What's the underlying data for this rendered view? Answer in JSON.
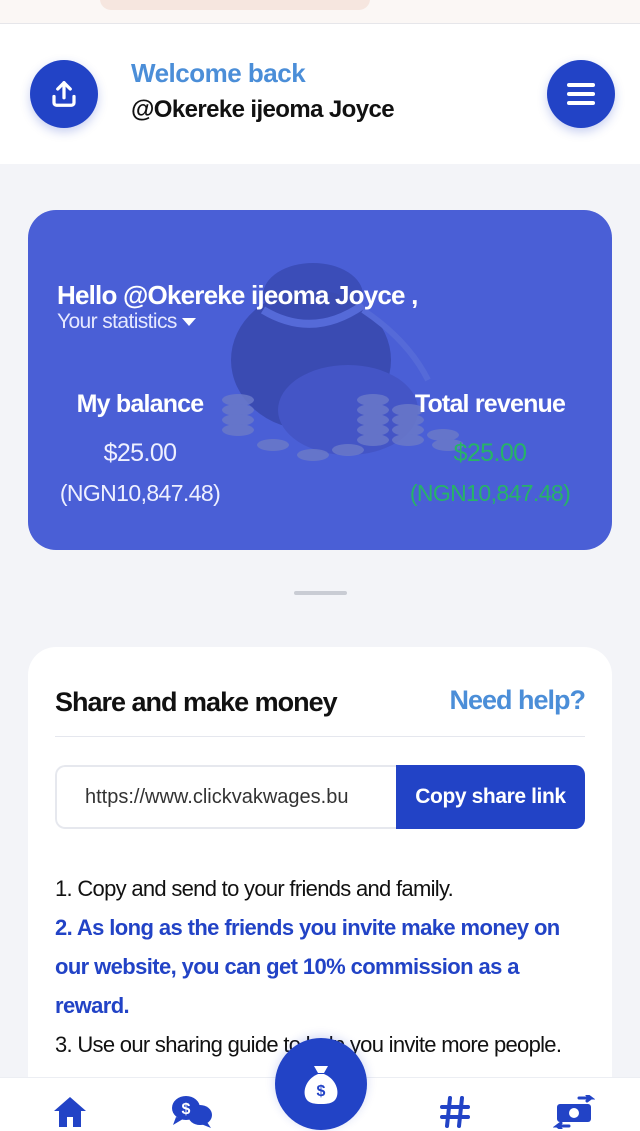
{
  "header": {
    "welcome": "Welcome back",
    "username": "@Okereke ijeoma Joyce"
  },
  "stats": {
    "greeting": "Hello @Okereke ijeoma Joyce ,",
    "subtitle": "Your statistics",
    "balance": {
      "label": "My balance",
      "usd": "$25.00",
      "ngn": "(NGN10,847.48)"
    },
    "revenue": {
      "label": "Total revenue",
      "usd": "$25.00",
      "ngn": "(NGN10,847.48)"
    }
  },
  "share": {
    "title": "Share and make money",
    "help": "Need help?",
    "link_value": "https://www.clickvakwages.bu",
    "copy_label": "Copy share link",
    "steps": [
      "1. Copy and send to your friends and family.",
      "2. As long as the friends you invite make money on our website, you can get 10% commission as a reward.",
      "3. Use our sharing guide to help you invite more people."
    ]
  },
  "nav": {
    "items": [
      "home-icon",
      "chat-dollar-icon",
      "money-bag-icon",
      "hash-icon",
      "exchange-icon"
    ]
  },
  "colors": {
    "primary": "#2243c6",
    "card": "#4a5fd6",
    "accent_blue": "#4b8ed8",
    "green": "#27b368"
  }
}
